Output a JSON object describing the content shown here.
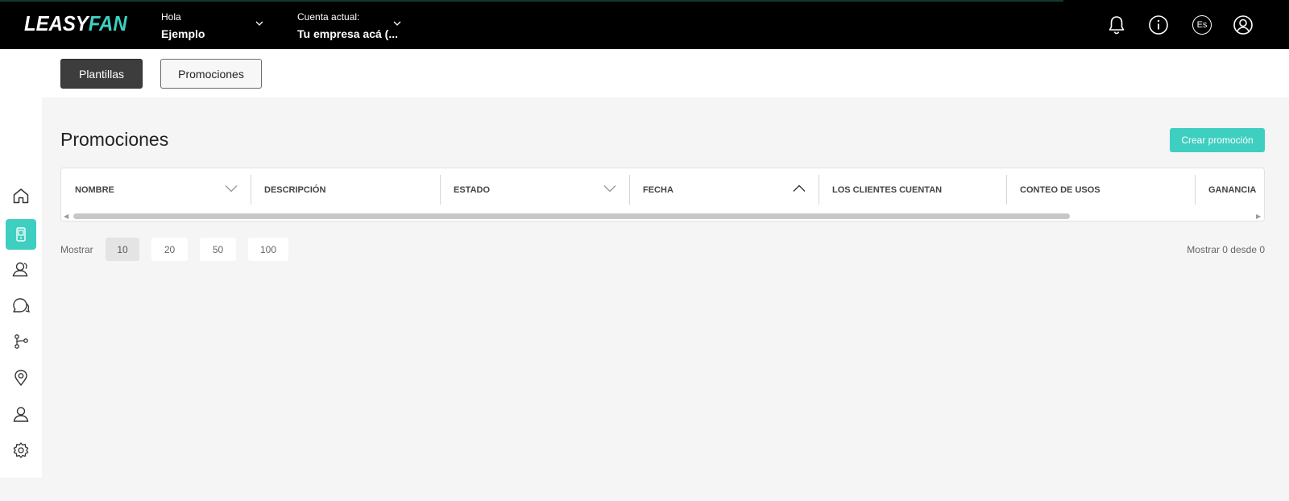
{
  "header": {
    "logo_part1": "LEASY",
    "logo_part2": "FAN",
    "greeting_label": "Hola",
    "user_name": "Ejemplo",
    "account_label": "Cuenta actual:",
    "account_name": "Tu empresa acá (...",
    "language": "Es",
    "icons": [
      "bell-icon",
      "info-icon",
      "language-icon",
      "user-icon"
    ]
  },
  "sidebar": {
    "items": [
      {
        "icon": "home-icon",
        "active": false
      },
      {
        "icon": "device-icon",
        "active": true
      },
      {
        "icon": "customers-icon",
        "active": false
      },
      {
        "icon": "chat-icon",
        "active": false
      },
      {
        "icon": "flow-icon",
        "active": false
      },
      {
        "icon": "location-icon",
        "active": false
      },
      {
        "icon": "profile-icon",
        "active": false
      },
      {
        "icon": "settings-icon",
        "active": false
      }
    ]
  },
  "tabs": {
    "templates": "Plantillas",
    "promotions": "Promociones",
    "active": "Plantillas"
  },
  "main": {
    "title": "Promociones",
    "create_button": "Crear promoción"
  },
  "table": {
    "columns": [
      {
        "label": "NOMBRE",
        "sort": "down"
      },
      {
        "label": "DESCRIPCIÓN",
        "sort": ""
      },
      {
        "label": "ESTADO",
        "sort": "down"
      },
      {
        "label": "FECHA",
        "sort": "up"
      },
      {
        "label": "LOS CLIENTES CUENTAN",
        "sort": ""
      },
      {
        "label": "CONTEO DE USOS",
        "sort": ""
      },
      {
        "label": "GANANCIA",
        "sort": ""
      }
    ],
    "rows": []
  },
  "pagination": {
    "show_label": "Mostrar",
    "page_sizes": [
      "10",
      "20",
      "50",
      "100"
    ],
    "selected": "10",
    "summary": "Mostrar 0 desde 0"
  },
  "colors": {
    "accent": "#3ecfc0",
    "header_bg": "#000000",
    "active_tab": "#3d3d3d"
  }
}
